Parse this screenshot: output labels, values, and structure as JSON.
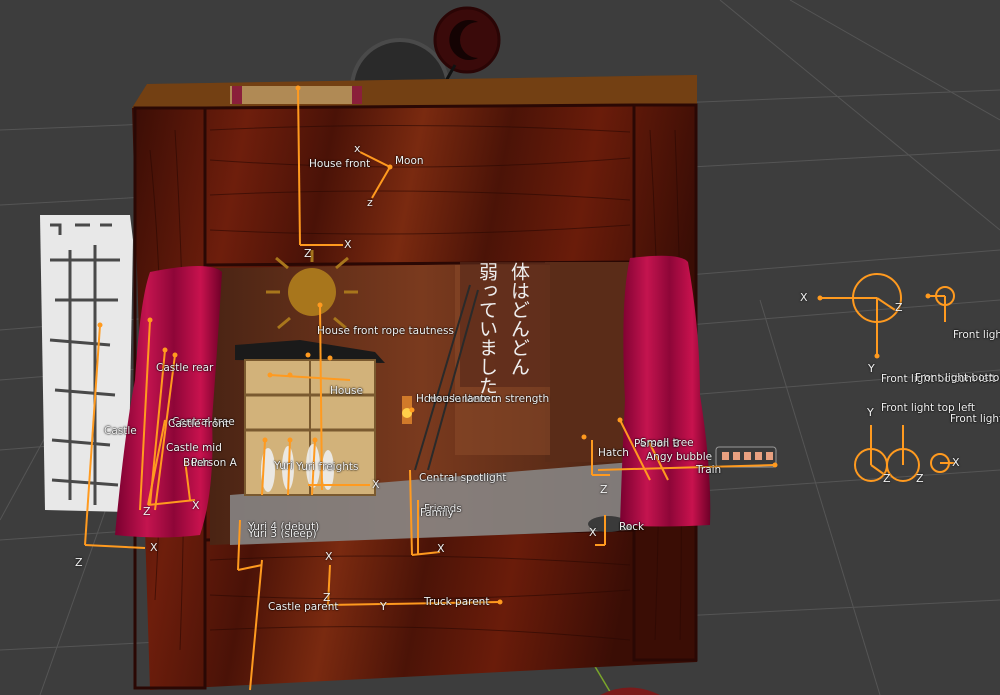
{
  "viewport": {
    "background": "#3d3d3d",
    "grid_color": "#555555",
    "rig_color": "#ff9a1f"
  },
  "labels": {
    "house_front": "House front",
    "moon": "Moon",
    "house_front_rope_tautness": "House front rope tautness",
    "castle_rear": "Castle rear",
    "house": "House",
    "house_lantern": "House lantern",
    "house_lantern_strength": "House lantern strength",
    "castle": "Castle",
    "central_tree": "Central tree",
    "castle_front": "Castle front",
    "castle_mid": "Castle mid",
    "bush": "Bush",
    "person_a": "Person A",
    "yuri": "Yuri",
    "yurifreights": "Yuri freights",
    "central_spotlight": "Central spotlight",
    "friends": "Friends",
    "family": "Family",
    "yuri4": "Yuri 4 (debut)",
    "yuri3": "Yuri 3 (sleep)",
    "castle_parent": "Castle parent",
    "truck_parent": "Truck parent",
    "hatch": "Hatch",
    "person_b": "Person B",
    "small_tree": "Small tree",
    "angy_bubble": "Angy bubble",
    "train": "Train",
    "rock": "Rock",
    "front_light_top_right": "Front light top right",
    "front_light_bottom_left": "Front light bottom left",
    "front_light_bottom": "Front light bottom",
    "front_light_top_left": "Front light top left",
    "front_light_right": "Front light right"
  },
  "axes": {
    "x": "X",
    "y": "Y",
    "z": "Z",
    "x_lower": "x",
    "z_lower": "z"
  },
  "backdrop_text": {
    "col1": "体はどんどん",
    "col2": "弱っていました。"
  }
}
